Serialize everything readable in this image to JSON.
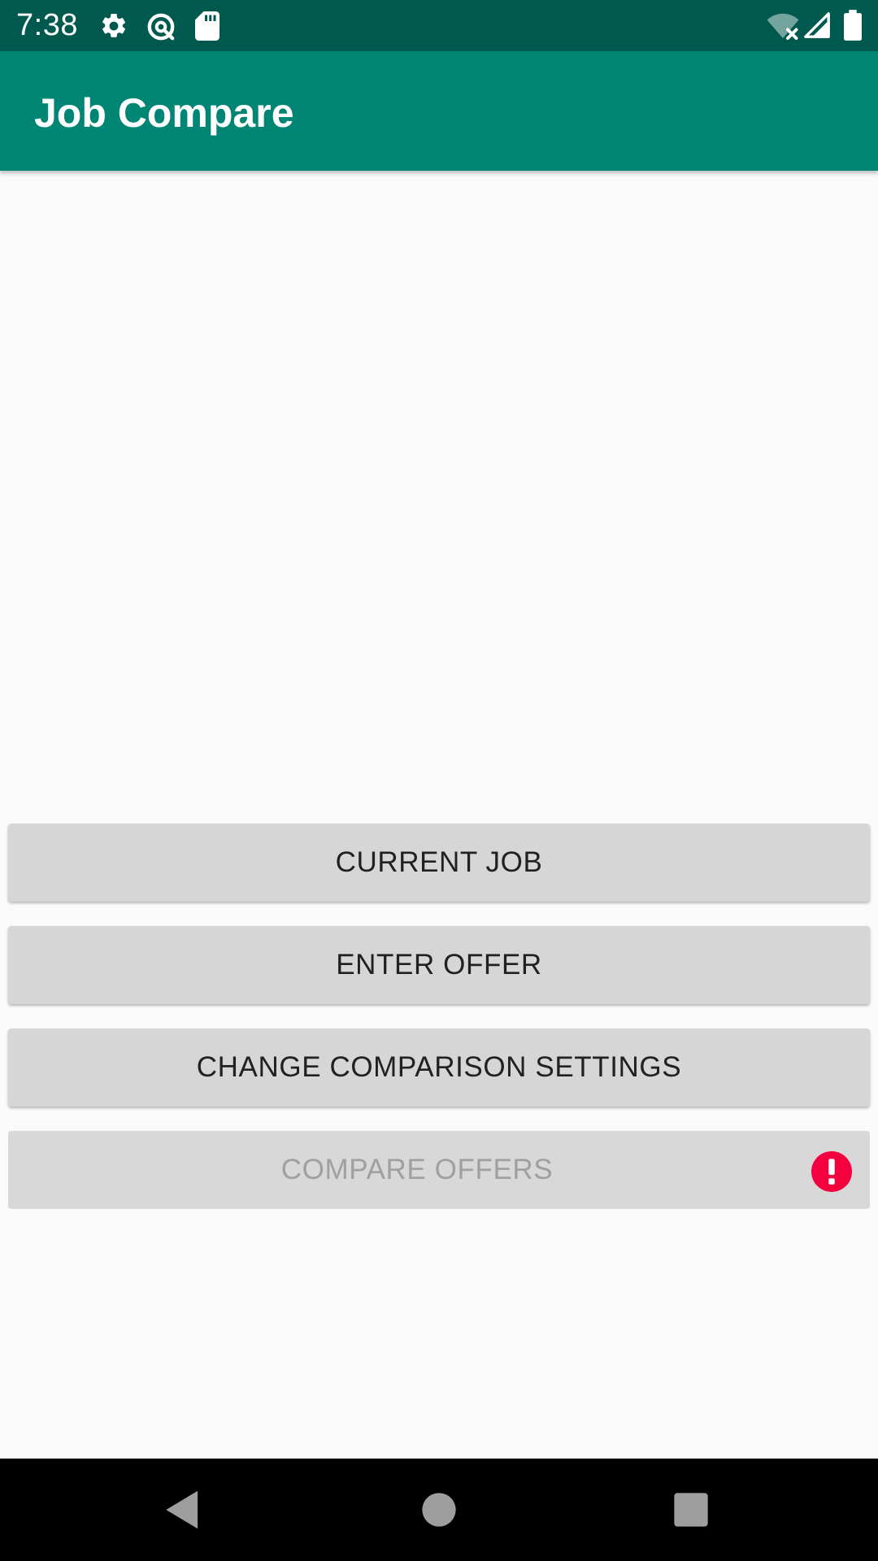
{
  "status_bar": {
    "time": "7:38",
    "left_icons": [
      "gear-icon",
      "data-saver-icon",
      "sd-card-icon"
    ],
    "right_icons": [
      "wifi-off-icon",
      "cell-signal-icon",
      "battery-icon"
    ]
  },
  "app_bar": {
    "title": "Job Compare",
    "color": "#018574"
  },
  "buttons": {
    "current_job": "CURRENT JOB",
    "enter_offer": "ENTER OFFER",
    "change_settings": "CHANGE COMPARISON SETTINGS",
    "compare_offers": "COMPARE OFFERS",
    "compare_offers_state": "disabled",
    "compare_offers_error_icon": "error-icon"
  },
  "nav_bar": {
    "icons": [
      "back-icon",
      "home-icon",
      "recents-icon"
    ]
  },
  "colors": {
    "status_bar": "#00594e",
    "accent": "#018574",
    "error": "#f5003f"
  }
}
